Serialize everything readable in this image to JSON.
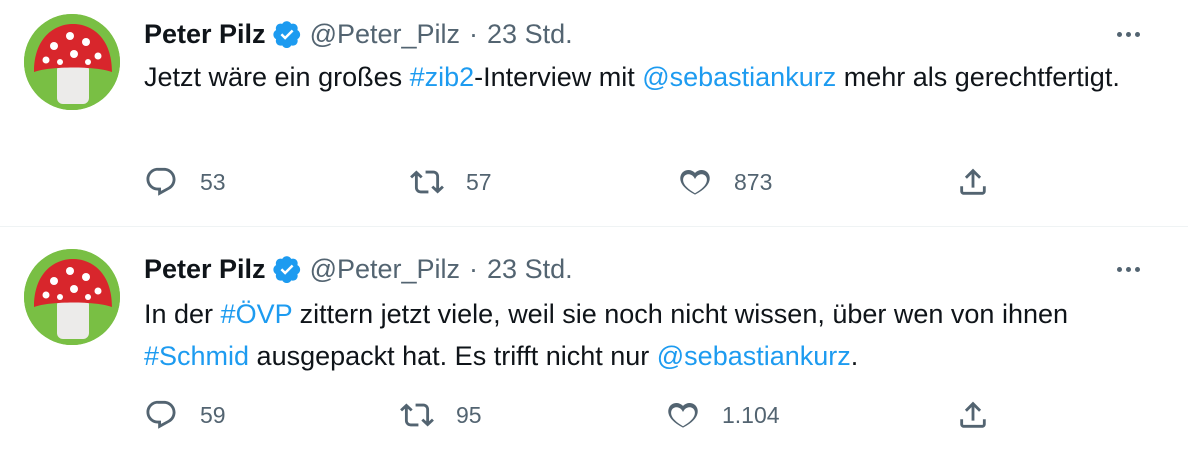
{
  "tweets": [
    {
      "name": "Peter Pilz",
      "handle": "@Peter_Pilz",
      "separator": "·",
      "time": "23 Std.",
      "text": {
        "p1": "Jetzt wäre ein großes ",
        "l1": "#zib2",
        "p2": "-Interview mit ",
        "l2": "@sebastiankurz",
        "p3": " mehr als gerechtfertigt."
      },
      "replies": "53",
      "retweets": "57",
      "likes": "873"
    },
    {
      "name": "Peter Pilz",
      "handle": "@Peter_Pilz",
      "separator": "·",
      "time": "23 Std.",
      "text": {
        "p1": "In der ",
        "l1": "#ÖVP",
        "p2": " zittern jetzt viele, weil sie noch nicht wissen, über wen von ihnen ",
        "l2": "#Schmid",
        "p3": " ausgepackt hat. Es trifft nicht nur ",
        "l3": "@sebastiankurz",
        "p4": "."
      },
      "replies": "59",
      "retweets": "95",
      "likes": "1.104"
    }
  ],
  "icons": {
    "avatar": "mushroom-avatar",
    "verified": "verified-badge-icon",
    "more": "more-dots-icon",
    "reply": "reply-icon",
    "retweet": "retweet-icon",
    "like": "heart-icon",
    "share": "share-icon"
  },
  "colors": {
    "link": "#1d9bf0",
    "secondary_text": "#536471",
    "primary_text": "#0f1419",
    "verified": "#1d9bf0",
    "divider": "#eff3f4"
  }
}
